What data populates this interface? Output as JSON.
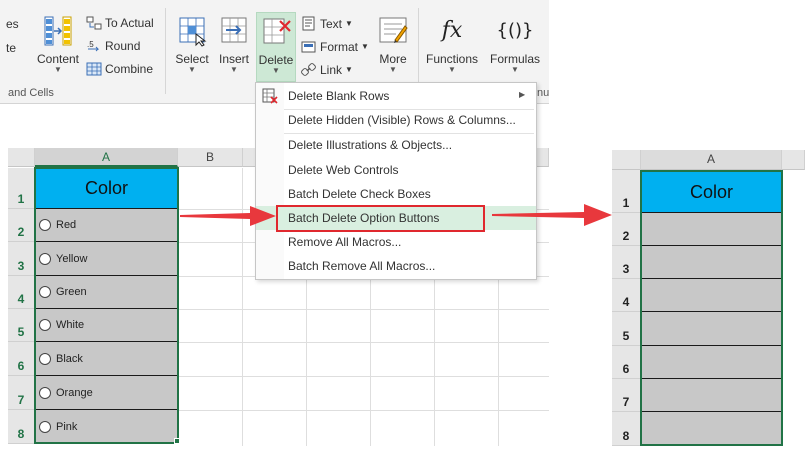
{
  "ribbon": {
    "partial_text_1": "es",
    "partial_text_2": "te",
    "content_label": "Content",
    "to_actual_label": "To Actual",
    "round_label": "Round",
    "combine_label": "Combine",
    "group_label": "and Cells",
    "select_label": "Select",
    "insert_label": "Insert",
    "delete_label": "Delete",
    "text_label": "Text",
    "format_label": "Format",
    "link_label": "Link",
    "more_label": "More",
    "functions_label": "Functions",
    "formulas_label": "Formulas",
    "fx_glyph": "fx",
    "formula_glyph": "{()}",
    "partial_group_right": "nu"
  },
  "menu": {
    "items": [
      {
        "label": "Delete Blank Rows"
      },
      {
        "label": "Delete Hidden (Visible) Rows & Columns..."
      },
      {
        "label": "Delete Illustrations & Objects..."
      },
      {
        "label": "Delete Web Controls"
      },
      {
        "label": "Batch Delete Check Boxes"
      },
      {
        "label": "Batch Delete Option Buttons"
      },
      {
        "label": "Remove All Macros..."
      },
      {
        "label": "Batch Remove All Macros..."
      }
    ],
    "highlighted_index": 5
  },
  "left_sheet": {
    "columns": [
      "A",
      "B"
    ],
    "rows": [
      "1",
      "2",
      "3",
      "4",
      "5",
      "6",
      "7",
      "8"
    ],
    "header_cell": "Color",
    "options": [
      "Red",
      "Yellow",
      "Green",
      "White",
      "Black",
      "Orange",
      "Pink"
    ]
  },
  "right_sheet": {
    "columns": [
      "A"
    ],
    "rows": [
      "1",
      "2",
      "3",
      "4",
      "5",
      "6",
      "7",
      "8"
    ],
    "header_cell": "Color"
  },
  "colors": {
    "header_fill": "#00b0f0",
    "cell_fill": "#c8c8c8",
    "excel_green": "#217346",
    "arrow_red": "#e8383d",
    "highlight_border": "#e0282e"
  }
}
